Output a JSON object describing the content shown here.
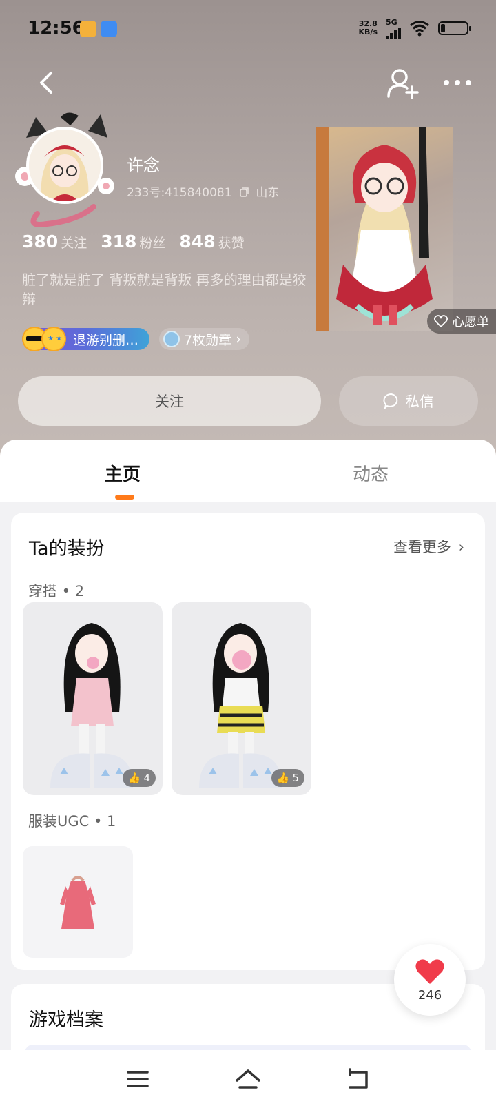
{
  "status_bar": {
    "time": "12:56",
    "net_speed_value": "32.8",
    "net_speed_unit": "KB/s",
    "network": "5G",
    "icons": [
      "weibo-icon",
      "app-icon",
      "signal-icon",
      "wifi-icon",
      "battery-icon"
    ]
  },
  "top_nav": {
    "icons": [
      "back-chevron-icon",
      "add-friend-icon",
      "more-dots-icon"
    ]
  },
  "profile": {
    "name": "许念",
    "id_text": "233号:415840081",
    "location": "山东",
    "stats": [
      {
        "value": "380",
        "label": "关注"
      },
      {
        "value": "318",
        "label": "粉丝"
      },
      {
        "value": "848",
        "label": "获赞"
      }
    ],
    "bio": "脏了就是脏了 背叛就是背叛 再多的理由都是狡辩",
    "title_badge": "退游别删…",
    "medals": "7枚勋章",
    "wishlist": "心愿单"
  },
  "actions": {
    "follow": "关注",
    "message": "私信"
  },
  "tabs": [
    {
      "label": "主页",
      "active": true
    },
    {
      "label": "动态",
      "active": false
    }
  ],
  "outfit_card": {
    "title": "Ta的装扮",
    "see_more": "查看更多",
    "outfits_label": "穿搭 • 2",
    "outfits": [
      {
        "likes": "4"
      },
      {
        "likes": "5"
      }
    ],
    "ugc_label": "服装UGC • 1"
  },
  "game_card": {
    "title": "游戏档案"
  },
  "floating_like": {
    "count": "246"
  },
  "colors": {
    "accent": "#ff7a1a",
    "heart": "#f03b4a"
  }
}
